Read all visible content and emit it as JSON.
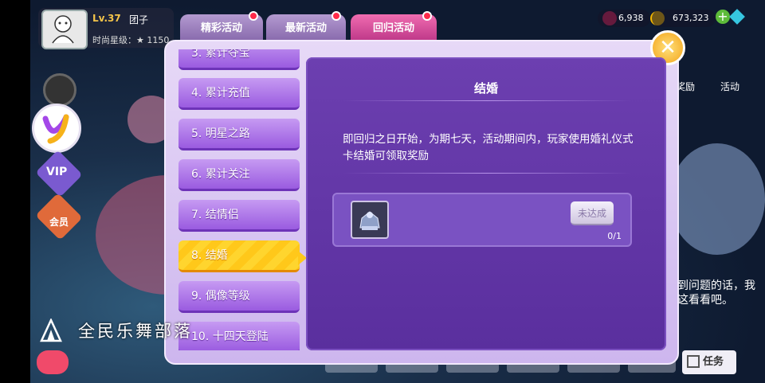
{
  "player": {
    "level": "Lv.37",
    "name": "团子",
    "fashion_label": "时尚星级：★ 1150"
  },
  "resources": [
    {
      "value": "6,938",
      "icon": "heart-gem-icon",
      "color": "#e0245e"
    },
    {
      "value": "673,323",
      "icon": "gold-coin-icon",
      "color": "#f5b800"
    }
  ],
  "tabs": [
    {
      "label": "精彩活动",
      "active": false,
      "badge": true
    },
    {
      "label": "最新活动",
      "active": false,
      "badge": true
    },
    {
      "label": "回归活动",
      "active": true,
      "badge": true
    }
  ],
  "list": {
    "items": [
      {
        "label": "3. 累计夺宝",
        "active": false
      },
      {
        "label": "4. 累计充值",
        "active": false
      },
      {
        "label": "5. 明星之路",
        "active": false
      },
      {
        "label": "6. 累计关注",
        "active": false
      },
      {
        "label": "7. 结情侣",
        "active": false
      },
      {
        "label": "8. 结婚",
        "active": true
      },
      {
        "label": "9. 偶像等级",
        "active": false
      },
      {
        "label": "10. 十四天登陆",
        "active": false
      }
    ]
  },
  "detail": {
    "title": "结婚",
    "description": "即回归之日开始，为期七天，活动期间内，玩家使用婚礼仪式卡结婚可领取奖励",
    "reward": {
      "icon": "wedding-ceremony-card-icon",
      "button_label": "未达成",
      "progress": "0/1"
    }
  },
  "watermark": {
    "text": "全民乐舞部落"
  },
  "background_labels": {
    "right_menu_1": "奖励",
    "right_menu_2": "活动",
    "help_text": "到问题的话，我这看看吧。",
    "task_button": "任务",
    "vip_label": "VIP",
    "member_label": "会员"
  },
  "colors": {
    "panel_bg": "#e7d9f7",
    "content_bg": "#5a2f9e",
    "item_bg": "#9a5be0",
    "active_item": "#ffc81a",
    "badge": "#ff2a4a"
  }
}
